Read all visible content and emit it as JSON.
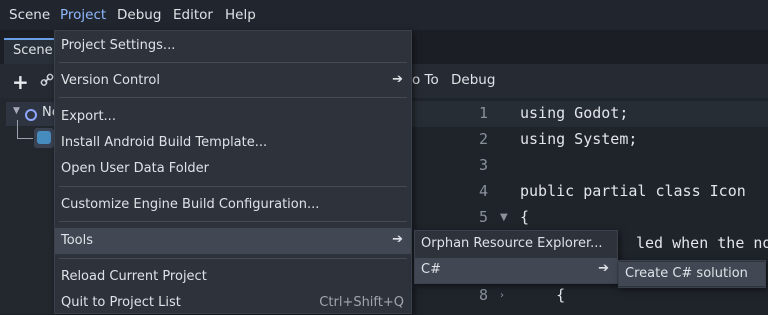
{
  "menubar": {
    "items": [
      "Scene",
      "Project",
      "Debug",
      "Editor",
      "Help"
    ]
  },
  "scene_dock": {
    "tab_label": "Scene",
    "add_icon": "plus-icon",
    "link_icon": "link-icon",
    "root_node_label": "Ne"
  },
  "script_editor": {
    "menu": {
      "goto_label": "o To",
      "debug_label": "Debug"
    },
    "lines": [
      {
        "num": "1",
        "text": "using Godot;"
      },
      {
        "num": "2",
        "text": "using System;"
      },
      {
        "num": "3",
        "text": ""
      },
      {
        "num": "4",
        "text": "public partial class Icon"
      },
      {
        "num": "5",
        "text": "{"
      },
      {
        "num": "",
        "text": "led when the no"
      },
      {
        "num": "",
        "text": ""
      },
      {
        "num": "8",
        "text": "    {"
      }
    ]
  },
  "project_menu": {
    "items": {
      "project_settings": "Project Settings...",
      "version_control": "Version Control",
      "export": "Export...",
      "install_android": "Install Android Build Template...",
      "open_user_data": "Open User Data Folder",
      "customize_build": "Customize Engine Build Configuration...",
      "tools": "Tools",
      "reload_project": "Reload Current Project",
      "quit_to_list": "Quit to Project List",
      "quit_shortcut": "Ctrl+Shift+Q"
    },
    "submenu_arrow": "chevron-right-icon"
  },
  "tools_submenu": {
    "orphan_explorer": "Orphan Resource Explorer...",
    "csharp": "C#"
  },
  "csharp_submenu": {
    "create_solution": "Create C# solution"
  },
  "colors": {
    "accent": "#8fb8ff",
    "menu_bg": "#2d323b",
    "highlight": "#414854"
  }
}
